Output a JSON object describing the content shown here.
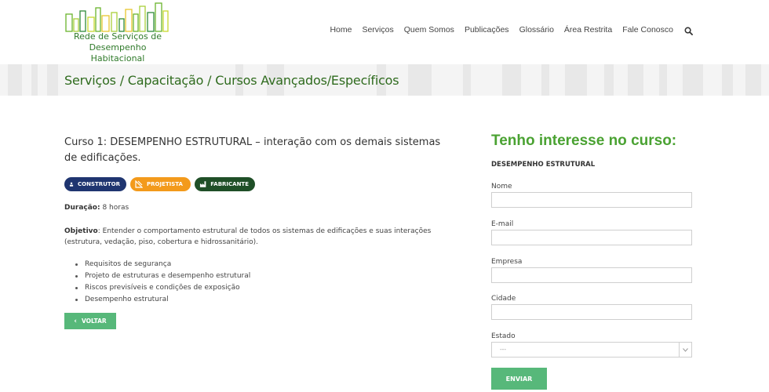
{
  "logo": {
    "line1": "Rede de Serviços de",
    "line2": "Desempenho Habitacional"
  },
  "nav": {
    "items": [
      "Home",
      "Serviços",
      "Quem Somos",
      "Publicações",
      "Glossário",
      "Área Restrita",
      "Fale Conosco"
    ]
  },
  "breadcrumb": "Serviços / Capacitação / Cursos Avançados/Específicos",
  "course": {
    "title": "Curso 1: DESEMPENHO ESTRUTURAL – interação com os demais sistemas de edificações.",
    "tags": [
      "CONSTRUTOR",
      "PROJETISTA",
      "FABRICANTE"
    ],
    "duration_label": "Duração:",
    "duration_value": " 8 horas",
    "objective_label": "Objetivo",
    "objective_value": ": Entender o comportamento estrutural de todos os sistemas de edificações e suas interações (estrutura, vedação, piso, cobertura e hidrossanitário).",
    "topics": [
      "Requisitos de segurança",
      "Projeto de estruturas e desempenho estrutural",
      "Riscos previsíveis e condições de exposição",
      "Desempenho estrutural"
    ],
    "back_label": "VOLTAR"
  },
  "form": {
    "title": "Tenho interesse no curso:",
    "course_name": "DESEMPENHO ESTRUTURAL",
    "labels": {
      "nome": "Nome",
      "email": "E-mail",
      "empresa": "Empresa",
      "cidade": "Cidade",
      "estado": "Estado"
    },
    "estado_selected": "---",
    "submit_label": "ENVIAR"
  },
  "colors": {
    "accent": "#57b87a",
    "title_green": "#4aa232",
    "construtor": "#1f3570",
    "projetista": "#f39a1b",
    "fabricante": "#1f4f27"
  }
}
